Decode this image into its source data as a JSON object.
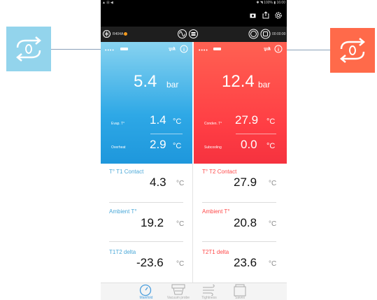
{
  "status": {
    "left": "▲ ⊟ ◀",
    "right": "✱ ◥ 100% ▮ 16:00"
  },
  "toolbar": {
    "refrigerant": "R404A",
    "timer": "00:00:00"
  },
  "left": {
    "pressure": "5.4",
    "pressure_unit": "bar",
    "evap_label": "Evap. T°",
    "evap_value": "1.4",
    "evap_unit": "°C",
    "overheat_label": "Overheat",
    "overheat_value": "2.9",
    "overheat_unit": "°C"
  },
  "right": {
    "pressure": "12.4",
    "pressure_unit": "bar",
    "conden_label": "Conden. T°",
    "conden_value": "27.9",
    "conden_unit": "°C",
    "subcooling_label": "Subcooling",
    "subcooling_value": "0.0",
    "subcooling_unit": "°C"
  },
  "sensors_left": [
    {
      "label": "T° T1 Contact",
      "value": "4.3",
      "unit": "°C"
    },
    {
      "label": "Ambient T°",
      "value": "19.2",
      "unit": "°C"
    },
    {
      "label": "T1T2 delta",
      "value": "-23.6",
      "unit": "°C"
    }
  ],
  "sensors_right": [
    {
      "label": "T° T2 Contact",
      "value": "27.9",
      "unit": "°C"
    },
    {
      "label": "Ambient T°",
      "value": "20.8",
      "unit": "°C"
    },
    {
      "label": "T2T1 delta",
      "value": "23.6",
      "unit": "°C"
    }
  ],
  "tabs": [
    "Manifold",
    "Vacuum probe",
    "Tightness",
    "Saves"
  ],
  "colors": {
    "blue": "#2ea8e6",
    "red": "#ff3d44",
    "label_blue": "#4aa8d8",
    "label_red": "#ff4a4a"
  },
  "icons": [
    "zero-reset-icon",
    "info-icon",
    "camera-icon",
    "share-icon",
    "settings-icon",
    "snowflake-icon",
    "wave-icon",
    "probe-icon",
    "record-icon",
    "stop-icon",
    "gauge-icon",
    "vacuum-icon",
    "wind-icon",
    "folder-icon",
    "battery-icon"
  ]
}
